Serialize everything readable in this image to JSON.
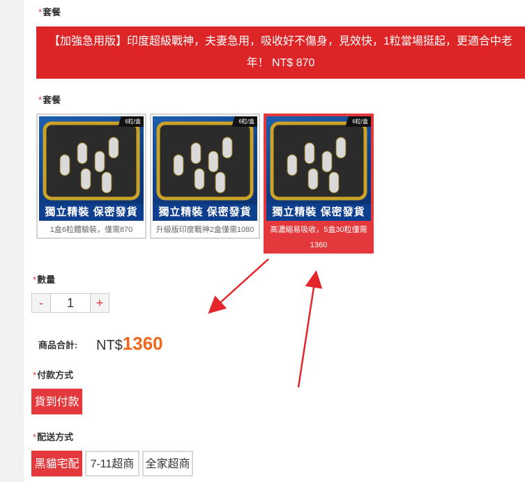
{
  "package_label": "套餐",
  "required_mark": "*",
  "banner": {
    "line1": "【加強急用版】印度超級戰神，夫妻急用，吸收好不傷身，見效快，1粒當場挺起，更適合中老",
    "line2": "年！ NT$ 870"
  },
  "package_label2": "套餐",
  "cards": [
    {
      "badge": "6粒/盒",
      "stripe": "獨立精裝 保密發貨",
      "caption": "1盒6粒體驗裝，僅需870",
      "selected": false
    },
    {
      "badge": "6粒/盒",
      "stripe": "獨立精裝 保密發貨",
      "caption": "升級版印度戰神2盒僅需1080",
      "selected": false
    },
    {
      "badge": "6粒/盒",
      "stripe": "獨立精裝 保密發貨",
      "caption": "高濃縮易吸收，5盒30粒僅需1360",
      "selected": true
    }
  ],
  "quantity": {
    "label": "數量",
    "minus": "-",
    "value": "1",
    "plus": "+"
  },
  "total": {
    "label": "商品合計:",
    "currency": "NT$",
    "amount": "1360"
  },
  "payment": {
    "label": "付款方式",
    "options": [
      "貨到付款"
    ]
  },
  "shipping": {
    "label": "配送方式",
    "options": [
      "黑貓宅配",
      "7-11超商",
      "全家超商"
    ]
  },
  "colors": {
    "accent": "#e4393c",
    "banner": "#dd2426",
    "price": "#f0661b"
  }
}
